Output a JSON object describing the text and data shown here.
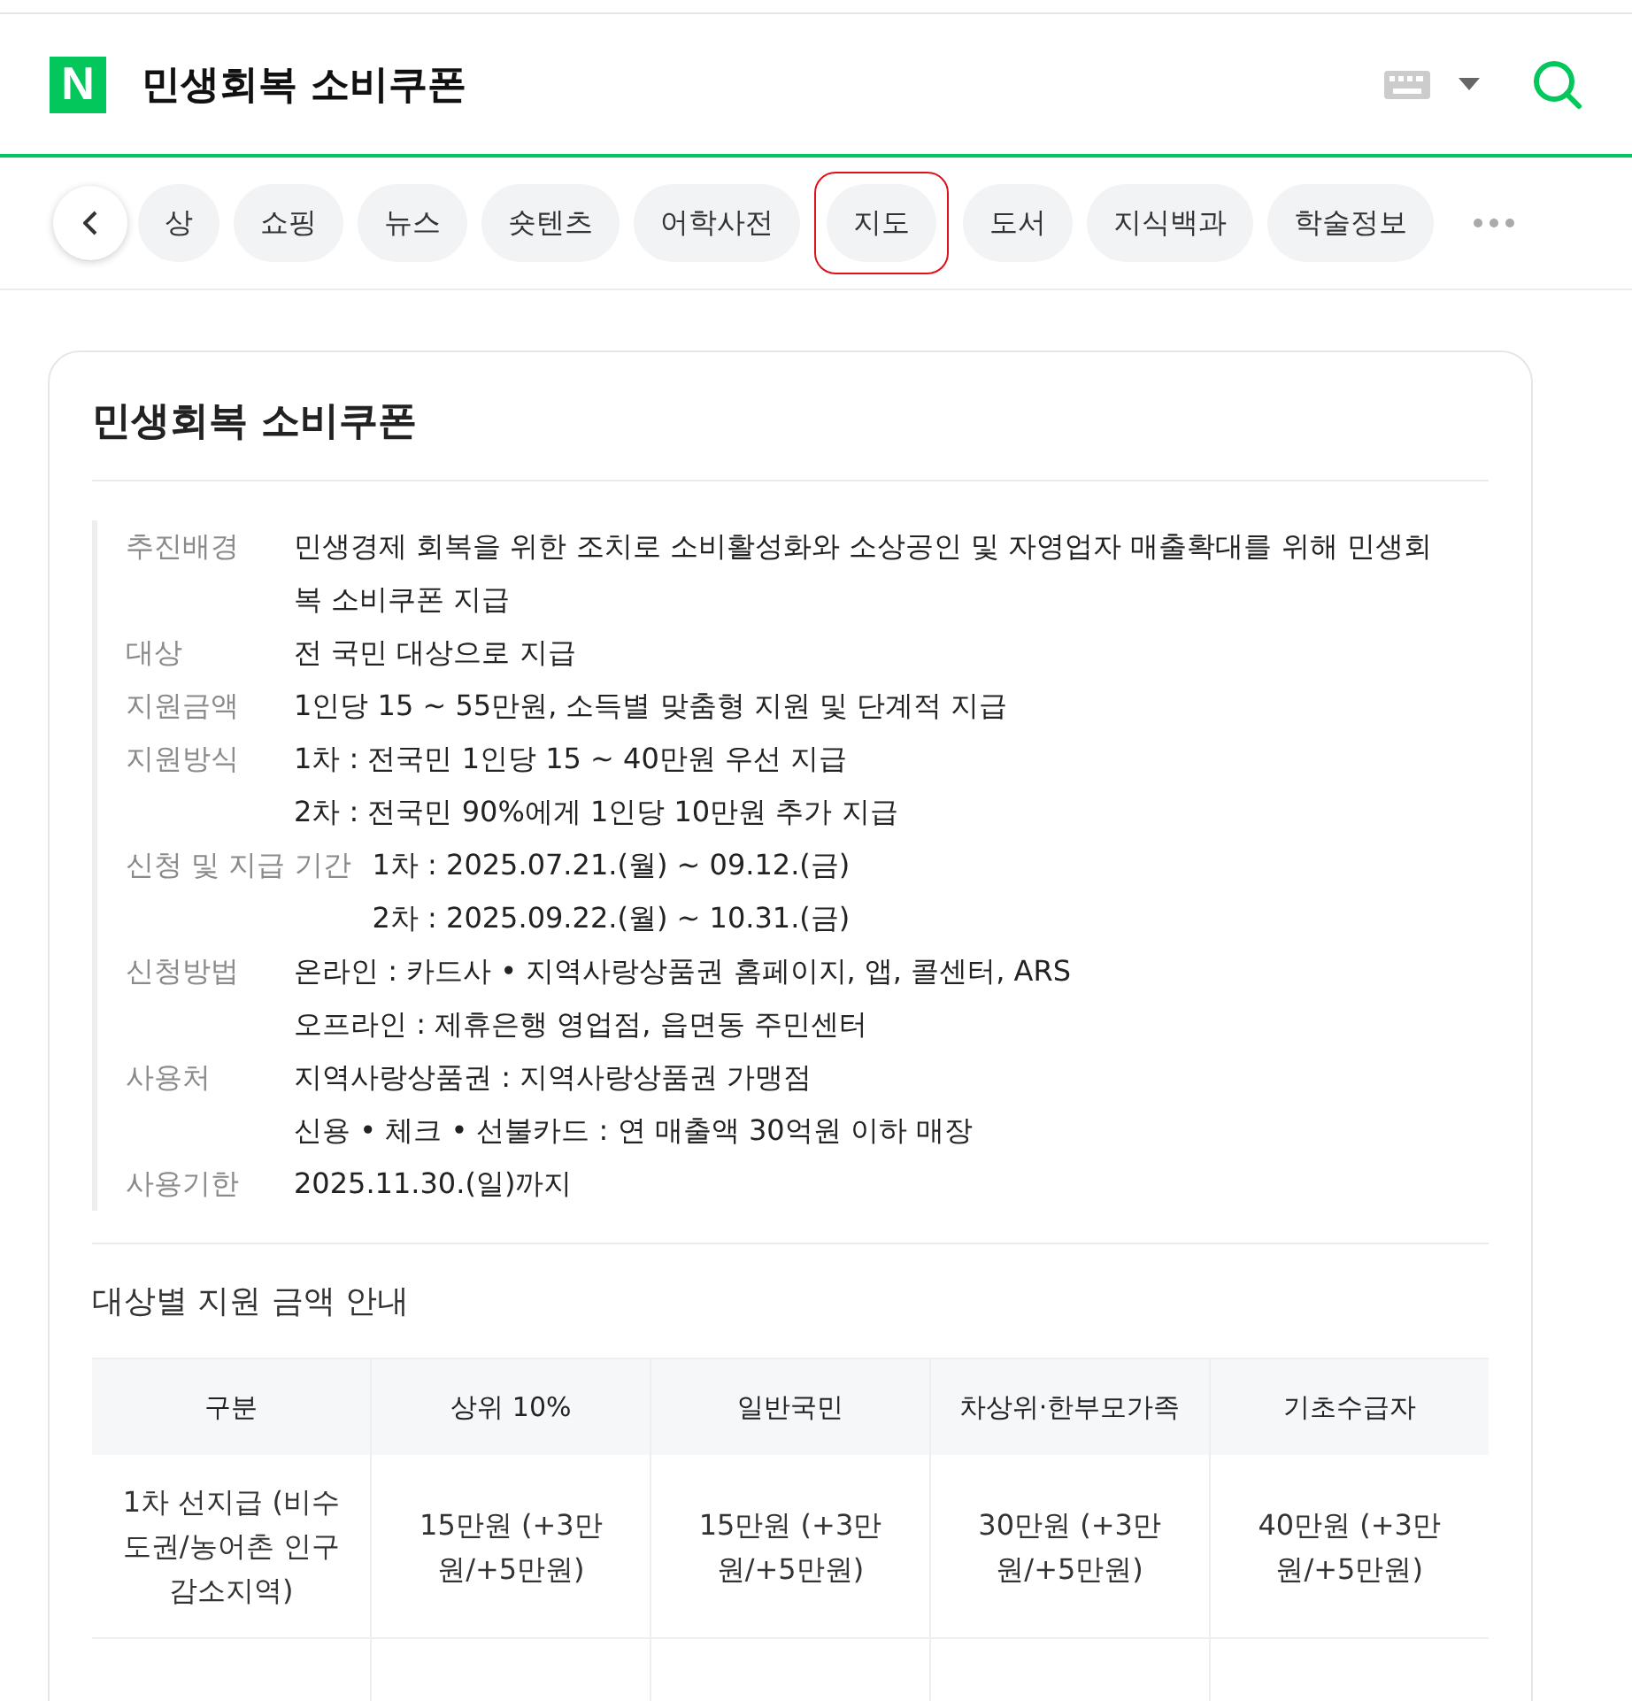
{
  "header": {
    "logo": "N",
    "query": "민생회복 소비쿠폰"
  },
  "tabs": [
    {
      "label": "상",
      "highlighted": false
    },
    {
      "label": "쇼핑",
      "highlighted": false
    },
    {
      "label": "뉴스",
      "highlighted": false
    },
    {
      "label": "숏텐츠",
      "highlighted": false
    },
    {
      "label": "어학사전",
      "highlighted": false
    },
    {
      "label": "지도",
      "highlighted": true
    },
    {
      "label": "도서",
      "highlighted": false
    },
    {
      "label": "지식백과",
      "highlighted": false
    },
    {
      "label": "학술정보",
      "highlighted": false
    }
  ],
  "card": {
    "title": "민생회복 소비쿠폰",
    "info": [
      {
        "label": "추진배경",
        "values": [
          "민생경제 회복을 위한 조치로 소비활성화와 소상공인 및 자영업자 매출확대를 위해 민생회복 소비쿠폰 지급"
        ]
      },
      {
        "label": "대상",
        "values": [
          "전 국민 대상으로 지급"
        ]
      },
      {
        "label": "지원금액",
        "values": [
          "1인당 15 ~ 55만원, 소득별 맞춤형 지원 및 단계적 지급"
        ]
      },
      {
        "label": "지원방식",
        "values": [
          "1차 : 전국민 1인당 15 ~ 40만원 우선 지급",
          "2차 : 전국민 90%에게 1인당 10만원 추가 지급"
        ]
      },
      {
        "label": "신청 및 지급 기간",
        "values": [
          "1차 : 2025.07.21.(월) ~ 09.12.(금)",
          "2차 : 2025.09.22.(월) ~ 10.31.(금)"
        ]
      },
      {
        "label": "신청방법",
        "values": [
          "온라인 : 카드사 • 지역사랑상품권 홈페이지, 앱, 콜센터, ARS",
          "오프라인 : 제휴은행 영업점, 읍면동 주민센터"
        ]
      },
      {
        "label": "사용처",
        "values": [
          "지역사랑상품권 : 지역사랑상품권 가맹점",
          "신용 • 체크 • 선불카드 : 연 매출액 30억원 이하 매장"
        ]
      },
      {
        "label": "사용기한",
        "values": [
          "2025.11.30.(일)까지"
        ]
      }
    ],
    "table_title": "대상별 지원 금액 안내",
    "table": {
      "columns": [
        "구분",
        "상위 10%",
        "일반국민",
        "차상위·한부모가족",
        "기초수급자"
      ],
      "rows": [
        [
          "1차 선지급 (비수도권/농어촌 인구감소지역)",
          "15만원 (+3만원/+5만원)",
          "15만원 (+3만원/+5만원)",
          "30만원 (+3만원/+5만원)",
          "40만원 (+3만원/+5만원)"
        ]
      ]
    }
  }
}
